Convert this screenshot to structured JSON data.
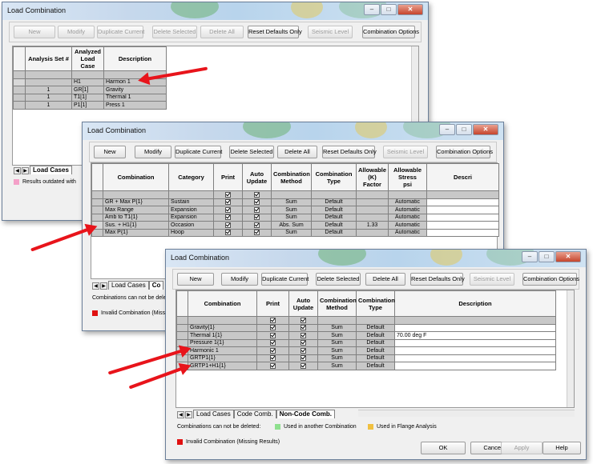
{
  "windows": {
    "w1": {
      "title": "Load Combination",
      "buttons": [
        "New",
        "Modify",
        "Duplicate Current",
        "Delete Selected",
        "Delete All",
        "Reset Defaults Only",
        "Seismic Level",
        "Combination Options"
      ],
      "headers": [
        "Analysis Set #",
        "Analyzed\nLoad Case",
        "Description"
      ],
      "rows": [
        [
          "",
          "H1",
          "Harmon 1"
        ],
        [
          "1",
          "GR[1]",
          "Gravity"
        ],
        [
          "1",
          "T1[1]",
          "Thermal 1"
        ],
        [
          "1",
          "P1[1]",
          "Press 1"
        ]
      ],
      "tab_label": "Load Cases",
      "legend_text": "Results outdated with"
    },
    "w2": {
      "title": "Load Combination",
      "buttons": [
        "New",
        "Modify",
        "Duplicate Current",
        "Delete Selected",
        "Delete All",
        "Reset Defaults Only",
        "Seismic Level",
        "Combination Options"
      ],
      "headers": [
        "Combination",
        "Category",
        "Print",
        "Auto\nUpdate",
        "Combination\nMethod",
        "Combination\nType",
        "Allowable\n(K) Factor",
        "Allowable\nStress\npsi",
        "Descri"
      ],
      "rows": [
        [
          "GR + Max P{1}",
          "Sustain",
          "Sum",
          "Default",
          "",
          "Automatic"
        ],
        [
          "Max Range",
          "Expansion",
          "Sum",
          "Default",
          "",
          "Automatic"
        ],
        [
          "Amb to T1{1}",
          "Expansion",
          "Sum",
          "Default",
          "",
          "Automatic"
        ],
        [
          "Sus. + H1{1}",
          "Occasion",
          "Abs. Sum",
          "Default",
          "1.33",
          "Automatic"
        ],
        [
          "Max P{1}",
          "Hoop",
          "Sum",
          "Default",
          "",
          "Automatic"
        ]
      ],
      "tab_label": "Load Cases",
      "tab_label2": "Co",
      "note": "Combinations can not be dele",
      "legend_invalid": "Invalid Combination (Missing"
    },
    "w3": {
      "title": "Load Combination",
      "buttons": [
        "New",
        "Modify",
        "Duplicate Current",
        "Delete Selected",
        "Delete All",
        "Reset Defaults Only",
        "Seismic Level",
        "Combination Options"
      ],
      "headers": [
        "Combination",
        "Print",
        "Auto\nUpdate",
        "Combination\nMethod",
        "Combination\nType",
        "Description"
      ],
      "rows": [
        [
          "Gravity{1}",
          "Sum",
          "Default",
          ""
        ],
        [
          "Thermal 1{1}",
          "Sum",
          "Default",
          "70.00 deg F"
        ],
        [
          "Pressure 1{1}",
          "Sum",
          "Default",
          ""
        ],
        [
          "Harmonic 1",
          "Sum",
          "Default",
          ""
        ],
        [
          "GRTP1{1}",
          "Sum",
          "Default",
          ""
        ],
        [
          "GRTP1+H1{1}",
          "Sum",
          "Default",
          ""
        ]
      ],
      "tabs": [
        "Load Cases",
        "Code Comb.",
        "Non-Code Comb."
      ],
      "note": "Combinations can not be deleted:",
      "legend_used": "Used in another Combination",
      "legend_flange": "Used in Flange Analysis",
      "legend_invalid": "Invalid Combination (Missing Results)",
      "footer_buttons": [
        "OK",
        "Cancel",
        "Apply",
        "Help"
      ]
    }
  },
  "colors": {
    "outdated": "#f4a0c8",
    "used": "#8ee08e",
    "flange": "#f0c040",
    "invalid": "#e01010",
    "arrow": "#e8141b"
  }
}
